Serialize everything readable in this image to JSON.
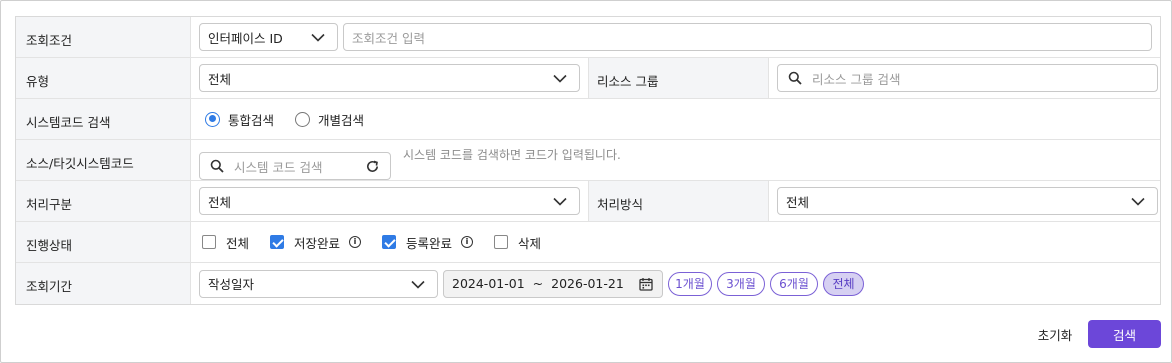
{
  "rows": {
    "query_condition": {
      "label": "조회조건",
      "type_value": "인터페이스 ID",
      "input_placeholder": "조회조건 입력"
    },
    "type": {
      "label": "유형",
      "value": "전체",
      "resource_group_label": "리소스 그룹",
      "resource_group_placeholder": "리소스 그룹 검색"
    },
    "system_code_search": {
      "label": "시스템코드 검색",
      "options": [
        "통합검색",
        "개별검색"
      ],
      "selected": "통합검색"
    },
    "source_target": {
      "label": "소스/타깃시스템코드",
      "search_placeholder": "시스템 코드 검색",
      "hint": "시스템 코드를 검색하면 코드가 입력됩니다."
    },
    "process_type": {
      "label": "처리구분",
      "value": "전체",
      "method_label": "처리방식",
      "method_value": "전체"
    },
    "progress_status": {
      "label": "진행상태",
      "options": [
        {
          "label": "전체",
          "checked": false,
          "info": false
        },
        {
          "label": "저장완료",
          "checked": true,
          "info": true
        },
        {
          "label": "등록완료",
          "checked": true,
          "info": true
        },
        {
          "label": "삭제",
          "checked": false,
          "info": false
        }
      ]
    },
    "period": {
      "label": "조회기간",
      "date_type": "작성일자",
      "start_date": "2024-01-01",
      "separator": "~",
      "end_date": "2026-01-21",
      "chips": [
        "1개월",
        "3개월",
        "6개월",
        "전체"
      ],
      "active_chip": "전체"
    }
  },
  "actions": {
    "reset_label": "초기화",
    "search_label": "검색"
  },
  "colors": {
    "primary": "#6c47d9",
    "check": "#2f7be5",
    "label_bg": "#f4f5f7"
  }
}
